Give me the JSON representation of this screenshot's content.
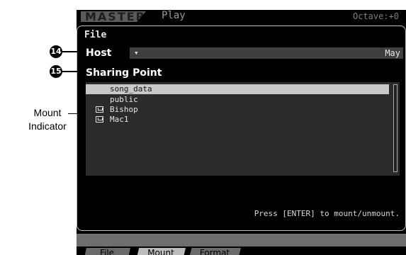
{
  "header": {
    "mode": "MASTER",
    "screen": "Play",
    "octave": "Octave:+0"
  },
  "panel": {
    "title": "File",
    "host": {
      "label": "Host",
      "dropdown_icon": "triangle-down-icon",
      "value": "May"
    },
    "sharing_point": {
      "label": "Sharing Point",
      "items": [
        {
          "name": "song_data",
          "selected": true,
          "mounted": false
        },
        {
          "name": "public",
          "selected": false,
          "mounted": false
        },
        {
          "name": "Bishop",
          "selected": false,
          "mounted": true
        },
        {
          "name": "Mac1",
          "selected": false,
          "mounted": true
        }
      ]
    },
    "status": "Press [ENTER] to mount/unmount."
  },
  "tabs": [
    {
      "label": "File",
      "active": false
    },
    {
      "label": "Mount",
      "active": true
    },
    {
      "label": "Format",
      "active": false
    }
  ],
  "callouts": {
    "host_number": "14",
    "sharing_number": "15",
    "mount_indicator": "Mount Indicator"
  }
}
